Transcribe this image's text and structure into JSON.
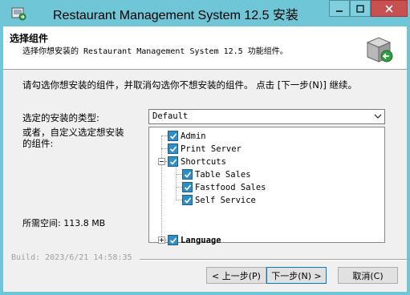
{
  "window": {
    "title": "Restaurant Management System 12.5 安装"
  },
  "header": {
    "title": "选择组件",
    "subtitle": "选择你想安装的 Restaurant Management System 12.5 功能组件。"
  },
  "intro": "请勾选你想安装的组件，并取消勾选你不想安装的组件。 点击 [下一步(N)] 继续。",
  "install_type": {
    "label": "选定的安装的类型:",
    "value": "Default"
  },
  "custom_label_line1": "或者，自定义选定想安装",
  "custom_label_line2": "的组件:",
  "components": {
    "admin": "Admin",
    "print_server": "Print Server",
    "shortcuts": "Shortcuts",
    "table_sales": "Table Sales",
    "fastfood_sales": "Fastfood Sales",
    "self_service": "Self Service",
    "language": "Language"
  },
  "space_required": "所需空间: 113.8 MB",
  "build": "Build: 2023/6/21 14:58:35",
  "buttons": {
    "back": "< 上一步(P)",
    "next": "下一步(N) >",
    "cancel": "取消(C)"
  }
}
